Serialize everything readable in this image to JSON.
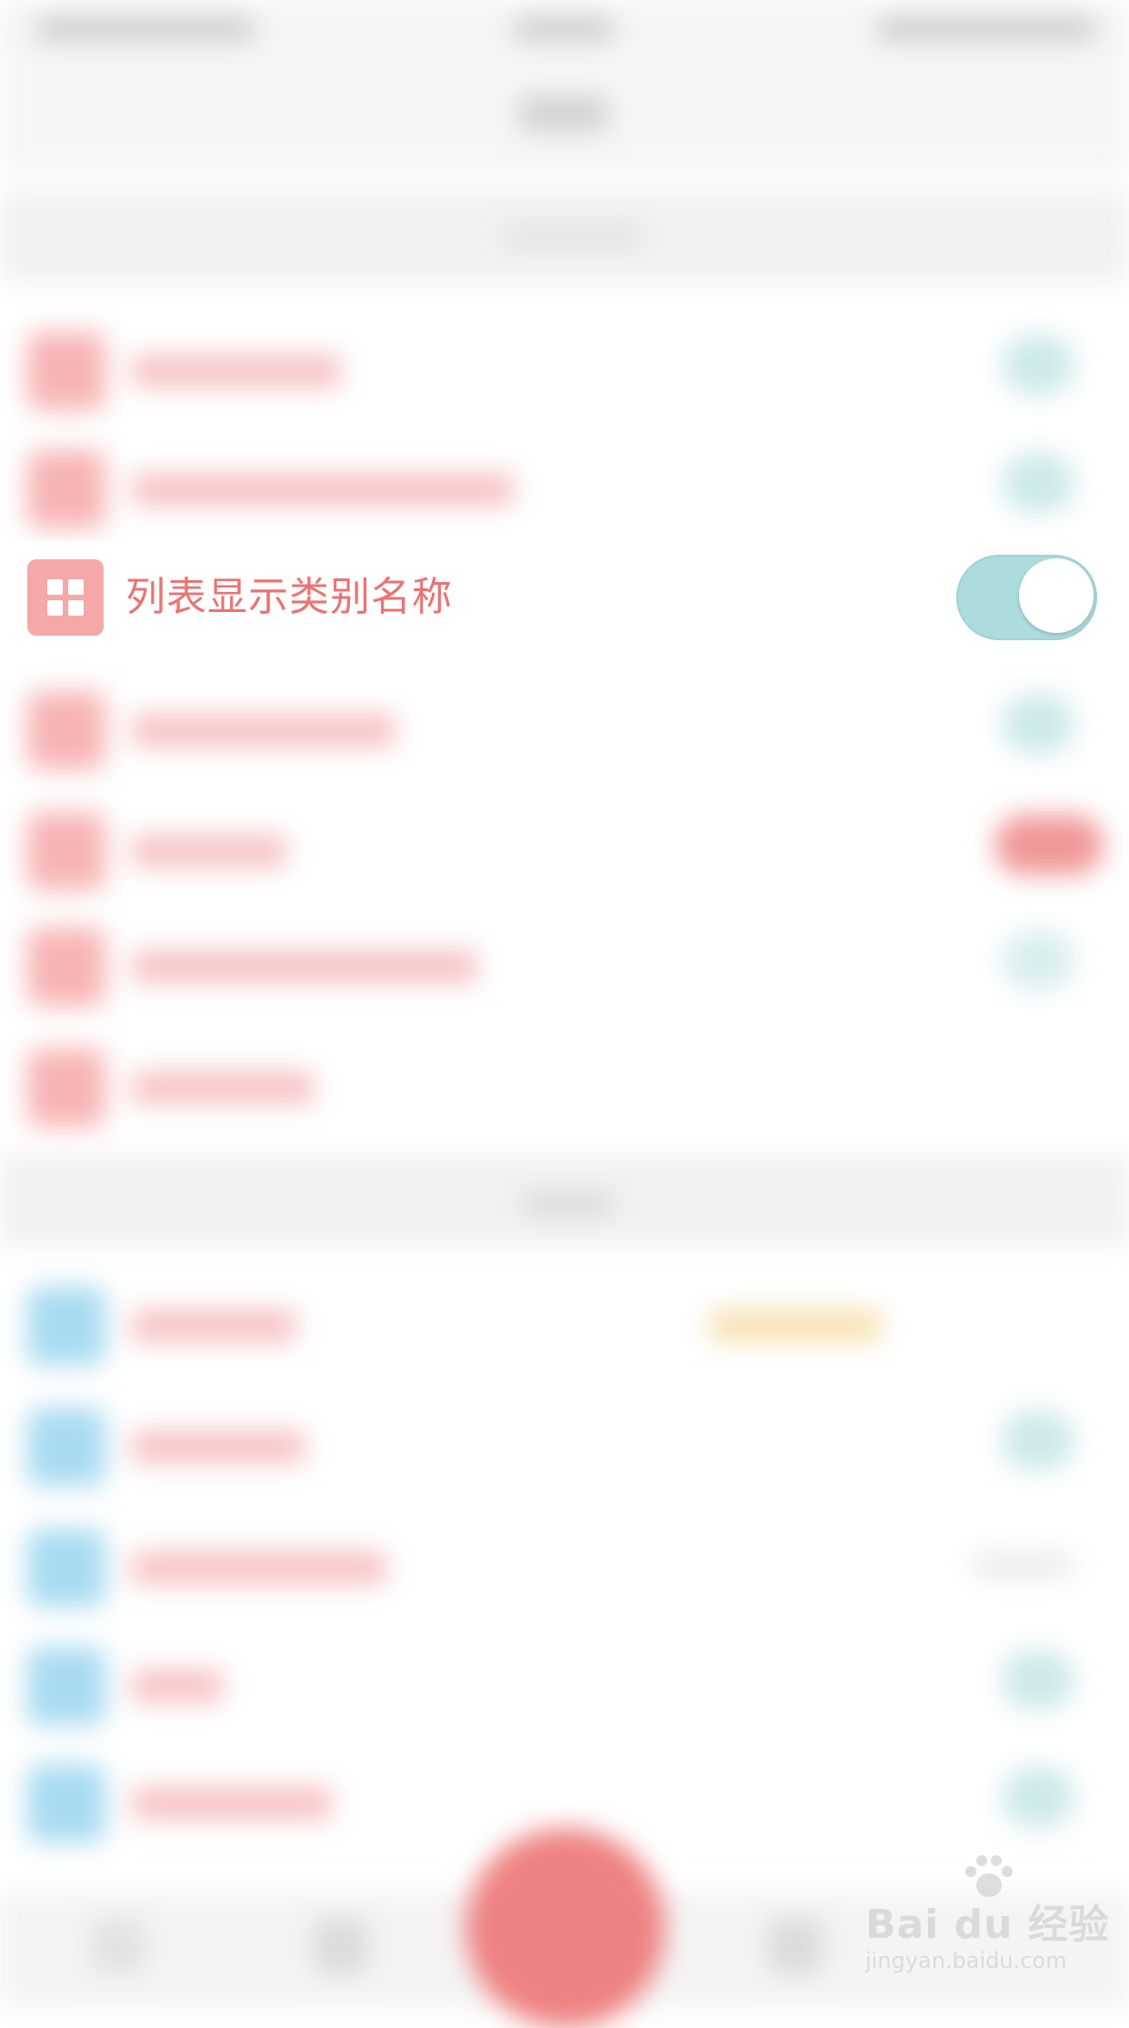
{
  "setting_row": {
    "label": "列表显示类别名称",
    "icon": "grid-icon",
    "toggle_on": true,
    "toggle_color": "#acdcdd",
    "icon_color": "#f4a8a8",
    "label_color": "#e97473"
  },
  "watermark": {
    "logo_text": "Bai du 经验",
    "url": "jingyan.baidu.com"
  }
}
